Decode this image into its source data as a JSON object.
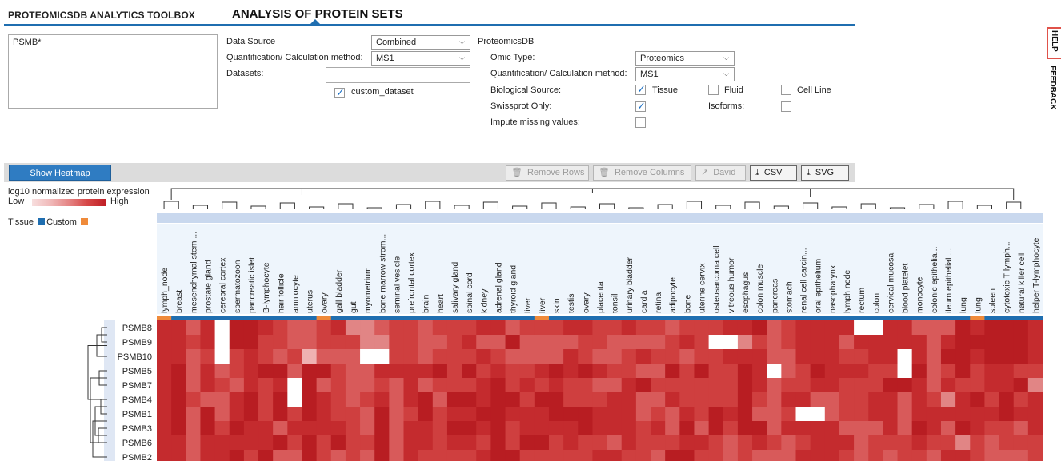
{
  "header": {
    "toolbox_title": "PROTEOMICSDB ANALYTICS TOOLBOX",
    "page_title": "ANALYSIS OF PROTEIN SETS"
  },
  "side_tabs": {
    "help": "HELP",
    "feedback": "FEEDBACK"
  },
  "query": {
    "text": "PSMB*"
  },
  "form": {
    "data_source_label": "Data Source",
    "data_source_value": "Combined",
    "quant_label": "Quantification/ Calculation method:",
    "quant_value": "MS1",
    "datasets_label": "Datasets:",
    "datasets_filter_value": "",
    "datasets": [
      {
        "name": "custom_dataset",
        "checked": true
      }
    ]
  },
  "proteomicsdb": {
    "section_label": "ProteomicsDB",
    "omic_type_label": "Omic Type:",
    "omic_type_value": "Proteomics",
    "quant_label": "Quantification/ Calculation method:",
    "quant_value": "MS1",
    "bio_source_label": "Biological Source:",
    "bio_sources": [
      {
        "label": "Tissue",
        "checked": true
      },
      {
        "label": "Fluid",
        "checked": false
      },
      {
        "label": "Cell Line",
        "checked": false
      }
    ],
    "swissprot_label": "Swissprot Only:",
    "swissprot_checked": true,
    "isoforms_label": "Isoforms:",
    "isoforms_checked": false,
    "impute_label": "Impute missing values:",
    "impute_checked": false
  },
  "toolbar": {
    "show_heatmap": "Show Heatmap",
    "remove_rows": "Remove Rows",
    "remove_columns": "Remove Columns",
    "david": "David",
    "csv": "CSV",
    "svg": "SVG"
  },
  "legend": {
    "title": "log10 normalized protein expression",
    "low": "Low",
    "high": "High",
    "tissue_label": "Tissue",
    "custom_label": "Custom",
    "tissue_color": "#1f6eb0",
    "custom_color": "#ef8a3a"
  },
  "heatmap": {
    "columns": [
      {
        "name": "lymph_node",
        "src": "custom"
      },
      {
        "name": "breast",
        "src": "tissue"
      },
      {
        "name": "mesenchymal stem ...",
        "src": "tissue"
      },
      {
        "name": "prostate gland",
        "src": "tissue"
      },
      {
        "name": "cerebral cortex",
        "src": "tissue"
      },
      {
        "name": "spermatozoon",
        "src": "tissue"
      },
      {
        "name": "pancreatic islet",
        "src": "tissue"
      },
      {
        "name": "B-lymphocyte",
        "src": "tissue"
      },
      {
        "name": "hair follicle",
        "src": "tissue"
      },
      {
        "name": "amniocyte",
        "src": "tissue"
      },
      {
        "name": "uterus",
        "src": "tissue"
      },
      {
        "name": "ovary",
        "src": "custom"
      },
      {
        "name": "gall bladder",
        "src": "tissue"
      },
      {
        "name": "gut",
        "src": "tissue"
      },
      {
        "name": "myometrium",
        "src": "tissue"
      },
      {
        "name": "bone marrow strom...",
        "src": "tissue"
      },
      {
        "name": "seminal vesicle",
        "src": "tissue"
      },
      {
        "name": "prefrontal cortex",
        "src": "tissue"
      },
      {
        "name": "brain",
        "src": "tissue"
      },
      {
        "name": "heart",
        "src": "tissue"
      },
      {
        "name": "salivary gland",
        "src": "tissue"
      },
      {
        "name": "spinal cord",
        "src": "tissue"
      },
      {
        "name": "kidney",
        "src": "tissue"
      },
      {
        "name": "adrenal gland",
        "src": "tissue"
      },
      {
        "name": "thyroid gland",
        "src": "tissue"
      },
      {
        "name": "liver",
        "src": "tissue"
      },
      {
        "name": "liver",
        "src": "custom"
      },
      {
        "name": "skin",
        "src": "tissue"
      },
      {
        "name": "testis",
        "src": "tissue"
      },
      {
        "name": "ovary",
        "src": "tissue"
      },
      {
        "name": "placenta",
        "src": "tissue"
      },
      {
        "name": "tonsil",
        "src": "tissue"
      },
      {
        "name": "urinary bladder",
        "src": "tissue"
      },
      {
        "name": "cardia",
        "src": "tissue"
      },
      {
        "name": "retina",
        "src": "tissue"
      },
      {
        "name": "adipocyte",
        "src": "tissue"
      },
      {
        "name": "bone",
        "src": "tissue"
      },
      {
        "name": "uterine cervix",
        "src": "tissue"
      },
      {
        "name": "osteosarcoma cell",
        "src": "tissue"
      },
      {
        "name": "vitreous humor",
        "src": "tissue"
      },
      {
        "name": "esophagus",
        "src": "tissue"
      },
      {
        "name": "colon muscle",
        "src": "tissue"
      },
      {
        "name": "pancreas",
        "src": "tissue"
      },
      {
        "name": "stomach",
        "src": "tissue"
      },
      {
        "name": "renal cell carcin...",
        "src": "tissue"
      },
      {
        "name": "oral epithelium",
        "src": "tissue"
      },
      {
        "name": "nasopharynx",
        "src": "tissue"
      },
      {
        "name": "lymph node",
        "src": "tissue"
      },
      {
        "name": "rectum",
        "src": "tissue"
      },
      {
        "name": "colon",
        "src": "tissue"
      },
      {
        "name": "cervical mucosa",
        "src": "tissue"
      },
      {
        "name": "blood platelet",
        "src": "tissue"
      },
      {
        "name": "monocyte",
        "src": "tissue"
      },
      {
        "name": "colonic epithelia...",
        "src": "tissue"
      },
      {
        "name": "ileum epithelial ...",
        "src": "tissue"
      },
      {
        "name": "lung",
        "src": "tissue"
      },
      {
        "name": "lung",
        "src": "custom"
      },
      {
        "name": "spleen",
        "src": "tissue"
      },
      {
        "name": "cytotoxic T-lymph...",
        "src": "tissue"
      },
      {
        "name": "natural killer cell",
        "src": "tissue"
      },
      {
        "name": "helper T-lymphocyte",
        "src": "tissue"
      }
    ],
    "rows": [
      "PSMB8",
      "PSMB9",
      "PSMB10",
      "PSMB5",
      "PSMB7",
      "PSMB4",
      "PSMB1",
      "PSMB3",
      "PSMB6",
      "PSMB2"
    ],
    "palette": [
      "#ffffff",
      "#efb2b2",
      "#e18585",
      "#d85a5a",
      "#cf3f3f",
      "#c42b2e",
      "#b81d22"
    ],
    "levels": [
      "5535066543345223443444553444554454434445563455550055333656665366",
      "5545066443344422443345336333344333345400243455535555535666665566",
      "5534045434133300443444543333543345443445553355544550536656665366",
      "5635345663664335555646454456565443364644650346555440634645544400",
      "5635435450634334353444564545443356444444653445544466535445562453",
      "5643356460654345356366566466444553354444643553344553542564645644",
      "5636356464654436346455665556665553435465633400344553555555655666",
      "5636465535555436355466564555565554536364663555533353653654435565",
      "5535555564646446355455464664544354445543454345553444544243444444",
      "5535564633643436354444566444445544366443433355543434435543334444"
    ]
  }
}
